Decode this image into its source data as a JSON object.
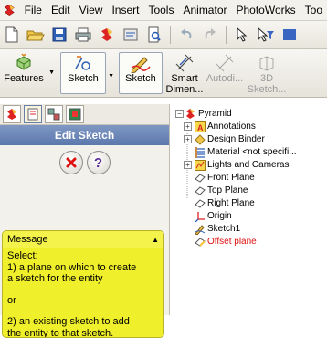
{
  "menubar": {
    "items": [
      "File",
      "Edit",
      "View",
      "Insert",
      "Tools",
      "Animator",
      "PhotoWorks",
      "Too"
    ]
  },
  "commands": {
    "features": "Features",
    "sketch1": "Sketch",
    "sketch2": "Sketch",
    "smart_dim_line1": "Smart",
    "smart_dim_line2": "Dimen...",
    "autodim_line1": "Autodi...",
    "sketch3d_line1": "3D",
    "sketch3d_line2": "Sketch..."
  },
  "panel": {
    "title": "Edit Sketch",
    "message_header": "Message",
    "message_lines": {
      "l1": "Select:",
      "l2": "1) a plane on which to create",
      "l3": "a sketch for the entity",
      "l4": "or",
      "l5": "2) an existing sketch to add",
      "l6": "the entity to that sketch."
    }
  },
  "tree": {
    "root": "Pyramid",
    "items": [
      "Annotations",
      "Design Binder",
      "Material <not specifi...",
      "Lights and Cameras",
      "Front Plane",
      "Top Plane",
      "Right Plane",
      "Origin",
      "Sketch1",
      "Offset plane"
    ]
  },
  "colors": {
    "message_bg": "#f0ef2c",
    "title_bar": "#6a86b8",
    "error_text": "#e01010"
  }
}
